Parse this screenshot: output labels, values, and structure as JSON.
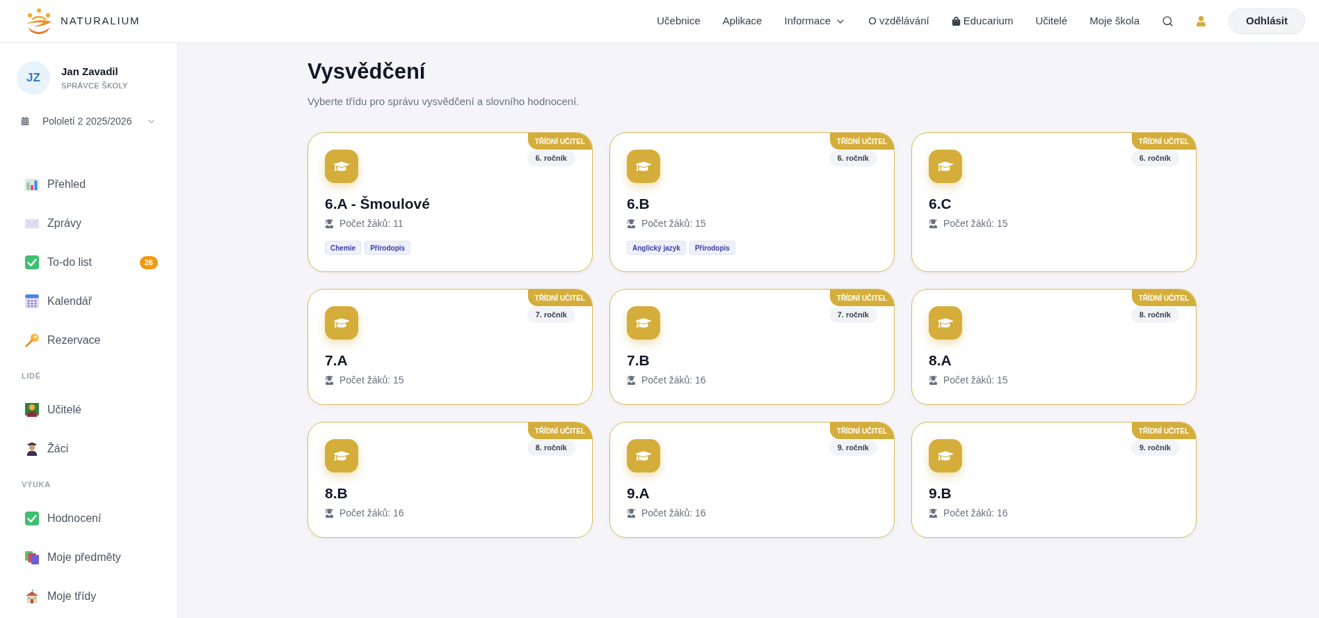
{
  "header": {
    "logo_text": "NATURALIUM",
    "nav": [
      {
        "label": "Učebnice",
        "kind": "link"
      },
      {
        "label": "Aplikace",
        "kind": "link"
      },
      {
        "label": "Informace",
        "kind": "dropdown"
      },
      {
        "label": "O vzdělávání",
        "kind": "link"
      },
      {
        "label": "Educarium",
        "kind": "store"
      },
      {
        "label": "Učitelé",
        "kind": "link"
      },
      {
        "label": "Moje škola",
        "kind": "link"
      }
    ],
    "logout": "Odhlásit"
  },
  "user": {
    "initials": "JZ",
    "name": "Jan Zavadil",
    "role": "SPRÁVCE ŠKOLY"
  },
  "term": "Pololetí 2 2025/2026",
  "sidebar": {
    "sections": [
      {
        "items": [
          {
            "label": "Přehled"
          },
          {
            "label": "Zprávy"
          },
          {
            "label": "To-do list",
            "badge": "26"
          },
          {
            "label": "Kalendář"
          },
          {
            "label": "Rezervace"
          }
        ]
      },
      {
        "heading": "LIDÉ",
        "items": [
          {
            "label": "Učitelé"
          },
          {
            "label": "Žáci"
          }
        ]
      },
      {
        "heading": "VÝUKA",
        "items": [
          {
            "label": "Hodnocení"
          },
          {
            "label": "Moje předměty"
          },
          {
            "label": "Moje třídy"
          }
        ]
      }
    ]
  },
  "page": {
    "title": "Vysvědčení",
    "subtitle": "Vyberte třídu pro správu vysvědčení a slovního hodnocení."
  },
  "cards": [
    {
      "name": "6.A - Šmoulové",
      "role_badge": "TŘÍDNÍ UČITEL",
      "grade": "6. ročník",
      "student_count": "Počet žáků: 11",
      "subjects": [
        "Chemie",
        "Přírodopis"
      ]
    },
    {
      "name": "6.B",
      "role_badge": "TŘÍDNÍ UČITEL",
      "grade": "6. ročník",
      "student_count": "Počet žáků: 15",
      "subjects": [
        "Anglický jazyk",
        "Přírodopis"
      ]
    },
    {
      "name": "6.C",
      "role_badge": "TŘÍDNÍ UČITEL",
      "grade": "6. ročník",
      "student_count": "Počet žáků: 15"
    },
    {
      "name": "7.A",
      "role_badge": "TŘÍDNÍ UČITEL",
      "grade": "7. ročník",
      "student_count": "Počet žáků: 15"
    },
    {
      "name": "7.B",
      "role_badge": "TŘÍDNÍ UČITEL",
      "grade": "7. ročník",
      "student_count": "Počet žáků: 16"
    },
    {
      "name": "8.A",
      "role_badge": "TŘÍDNÍ UČITEL",
      "grade": "8. ročník",
      "student_count": "Počet žáků: 15"
    },
    {
      "name": "8.B",
      "role_badge": "TŘÍDNÍ UČITEL",
      "grade": "8. ročník",
      "student_count": "Počet žáků: 16"
    },
    {
      "name": "9.A",
      "role_badge": "TŘÍDNÍ UČITEL",
      "grade": "9. ročník",
      "student_count": "Počet žáků: 16"
    },
    {
      "name": "9.B",
      "role_badge": "TŘÍDNÍ UČITEL",
      "grade": "9. ročník",
      "student_count": "Počet žáků: 16"
    }
  ]
}
